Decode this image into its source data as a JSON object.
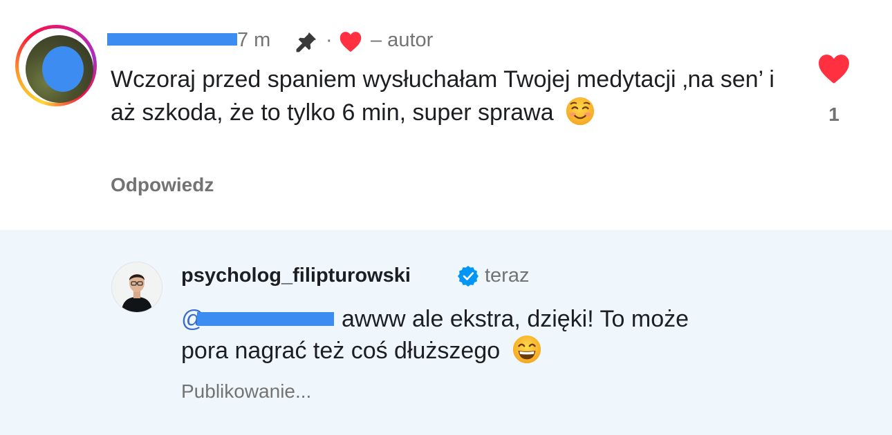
{
  "comment": {
    "time_partial": "7 m",
    "separator": "·",
    "author_label": "– autor",
    "text": "Wczoraj przed spaniem wysłuchałam Twojej medytacji ‚na sen’ i aż szkoda, że to tylko 6 min, super sprawa",
    "reply_label": "Odpowiedz",
    "like_count": "1",
    "emoji": "smiling-face-icon"
  },
  "reply": {
    "username": "psycholog_filipturowski",
    "time": "teraz",
    "mention_prefix": "@",
    "text_line1": "awww ale ekstra, dzięki! To może",
    "text_line2": "pora nagrać też coś dłuższego",
    "status": "Publikowanie...",
    "emoji": "grinning-face-icon"
  },
  "colors": {
    "heart": "#ff3040",
    "redaction": "#3c8cf2",
    "reply_bg": "#eff7fc",
    "verified": "#0095f6",
    "muted": "#737373"
  }
}
